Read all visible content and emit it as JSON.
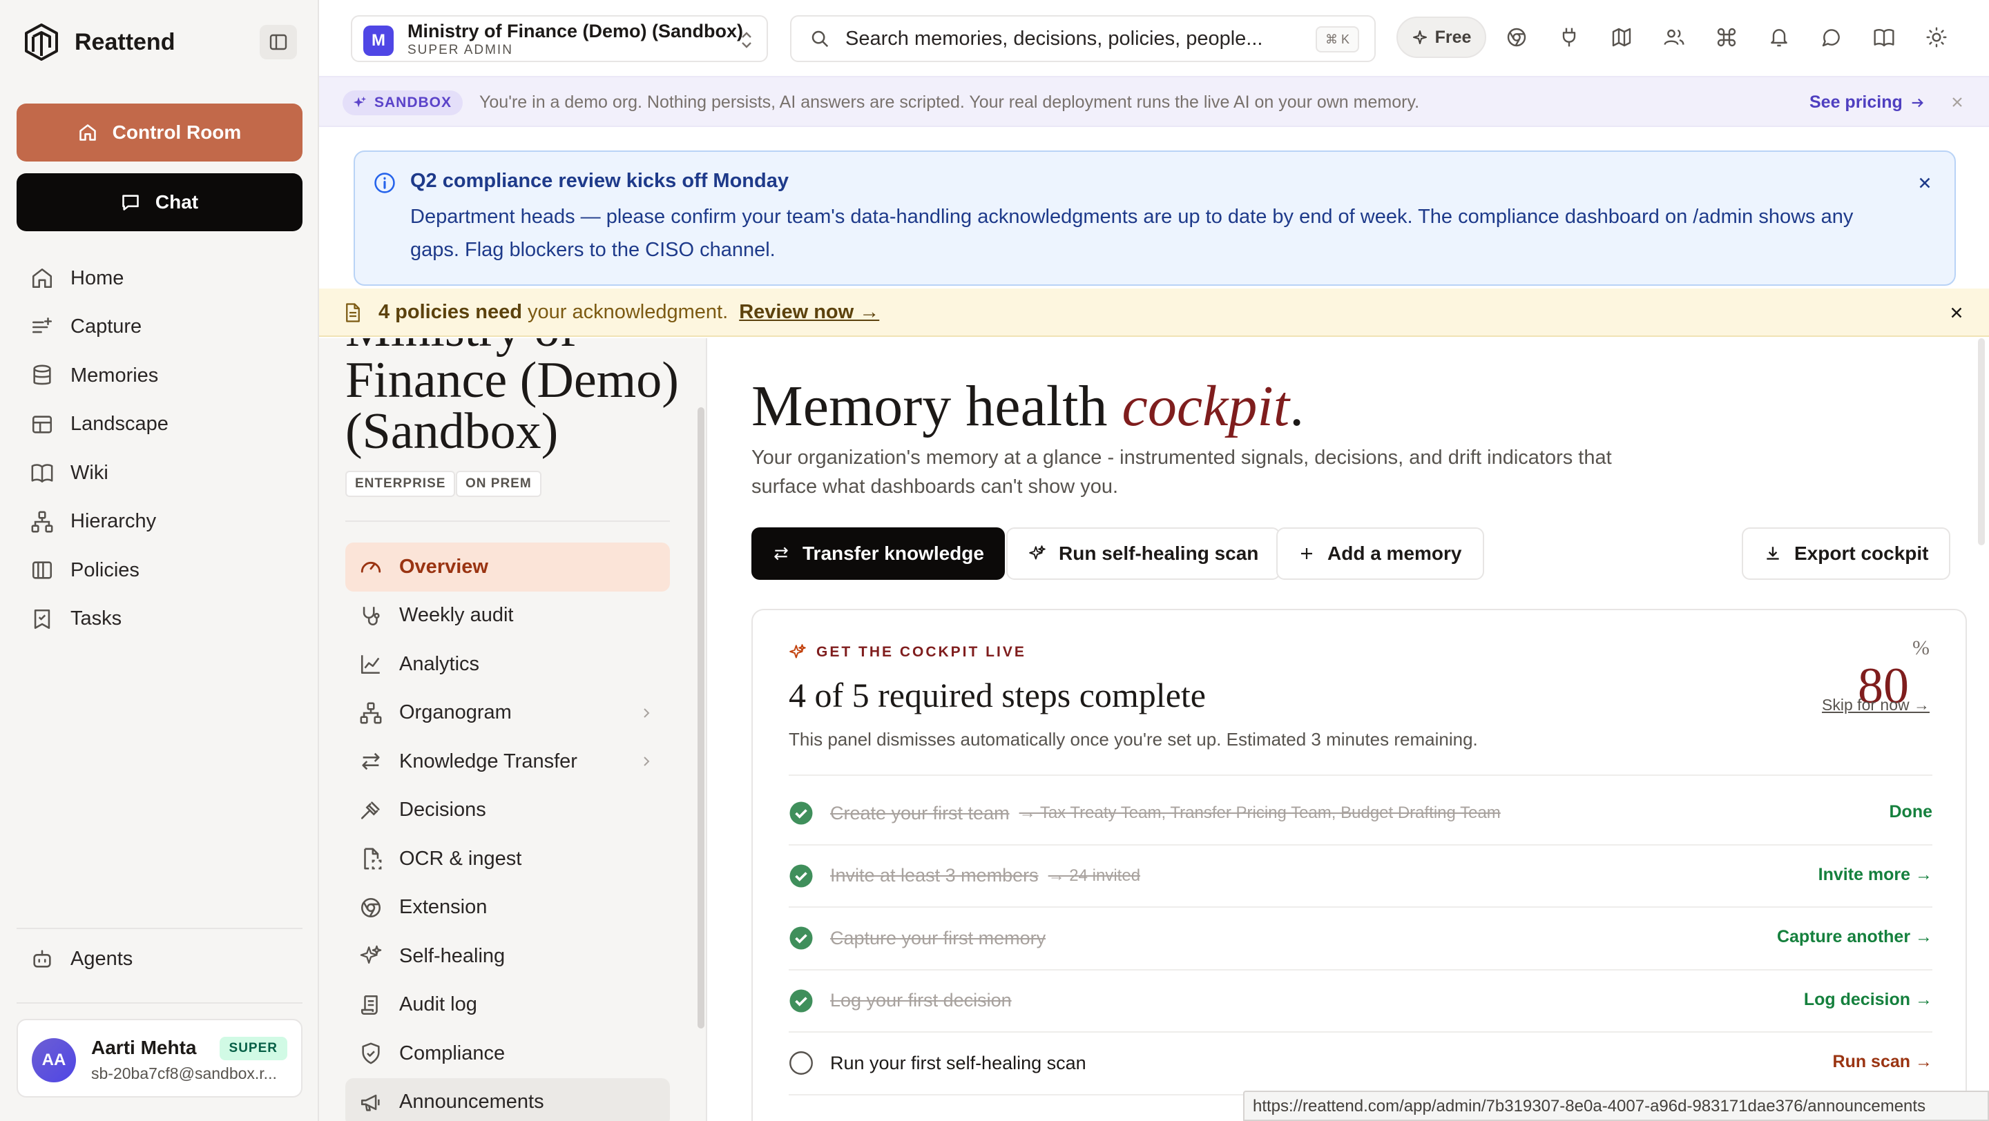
{
  "app": {
    "name": "Reattend"
  },
  "sidebar": {
    "primary_buttons": [
      {
        "label": "Control Room",
        "icon": "home-icon"
      },
      {
        "label": "Chat",
        "icon": "chat-bubble-icon"
      }
    ],
    "items": [
      {
        "label": "Home",
        "icon": "home-icon"
      },
      {
        "label": "Capture",
        "icon": "capture-icon"
      },
      {
        "label": "Memories",
        "icon": "database-icon"
      },
      {
        "label": "Landscape",
        "icon": "landscape-icon"
      },
      {
        "label": "Wiki",
        "icon": "book-icon"
      },
      {
        "label": "Hierarchy",
        "icon": "hierarchy-icon"
      },
      {
        "label": "Policies",
        "icon": "policies-icon"
      },
      {
        "label": "Tasks",
        "icon": "tasks-icon"
      }
    ],
    "agents_label": "Agents",
    "user": {
      "initials": "AA",
      "name": "Aarti Mehta",
      "badge": "SUPER",
      "email": "sb-20ba7cf8@sandbox.r..."
    }
  },
  "topbar": {
    "org": {
      "initial": "M",
      "name": "Ministry of Finance (Demo) (Sandbox)",
      "role": "SUPER ADMIN"
    },
    "search": {
      "placeholder": "Search memories, decisions, policies, people...",
      "shortcut": "⌘ K"
    },
    "plan": "Free",
    "icons": [
      "chrome-icon",
      "plug-icon",
      "map-icon",
      "users-icon",
      "command-icon",
      "bell-icon",
      "message-icon",
      "book-open-icon",
      "sun-icon"
    ]
  },
  "sandbox_banner": {
    "tag": "SANDBOX",
    "text": "You're in a demo org. Nothing persists, AI answers are scripted. Your real deployment runs the live AI on your own memory.",
    "link": "See pricing"
  },
  "announcement": {
    "title": "Q2 compliance review kicks off Monday",
    "body": "Department heads — please confirm your team's data-handling acknowledgments are up to date by end of week. The compliance dashboard on /admin shows any gaps. Flag blockers to the CISO channel."
  },
  "policy_banner": {
    "bold": "4 policies need",
    "text": "your acknowledgment.",
    "link": "Review now →"
  },
  "subnav": {
    "org_title": "Ministry of Finance (Demo) (Sandbox)",
    "tags": [
      "ENTERPRISE",
      "ON PREM"
    ],
    "items": [
      {
        "label": "Overview",
        "icon": "gauge-icon",
        "active": true
      },
      {
        "label": "Weekly audit",
        "icon": "stethoscope-icon"
      },
      {
        "label": "Analytics",
        "icon": "line-chart-icon"
      },
      {
        "label": "Organogram",
        "icon": "org-chart-icon",
        "chevron": true
      },
      {
        "label": "Knowledge Transfer",
        "icon": "transfer-icon",
        "chevron": true
      },
      {
        "label": "Decisions",
        "icon": "gavel-icon"
      },
      {
        "label": "OCR & ingest",
        "icon": "file-scan-icon"
      },
      {
        "label": "Extension",
        "icon": "chrome-icon"
      },
      {
        "label": "Self-healing",
        "icon": "sparkles-icon"
      },
      {
        "label": "Audit log",
        "icon": "scroll-icon"
      },
      {
        "label": "Compliance",
        "icon": "shield-check-icon"
      },
      {
        "label": "Announcements",
        "icon": "megaphone-icon",
        "hover": true
      }
    ]
  },
  "main": {
    "title_plain": "Memory health",
    "title_em": "cockpit",
    "title_end": ".",
    "subtitle": "Your organization's memory at a glance - instrumented signals, decisions, and drift indicators that surface what dashboards can't show you.",
    "actions": [
      {
        "label": "Transfer knowledge",
        "icon": "transfer-icon"
      },
      {
        "label": "Run self-healing scan",
        "icon": "sparkles-icon"
      },
      {
        "label": "Add a memory",
        "icon": "plus-icon"
      }
    ],
    "export_label": "Export cockpit",
    "setup": {
      "eyebrow": "GET THE COCKPIT LIVE",
      "title": "4 of 5 required steps complete",
      "description": "This panel dismisses automatically once you're set up. Estimated 3 minutes remaining.",
      "percent": "80",
      "percent_symbol": "%",
      "skip": "Skip for now →",
      "steps": [
        {
          "label": "Create your first team",
          "detail": "→ Tax Treaty Team, Transfer Pricing Team, Budget Drafting Team",
          "action": "Done",
          "done": true
        },
        {
          "label": "Invite at least 3 members",
          "detail": "→ 24 invited",
          "action": "Invite more →",
          "done": true
        },
        {
          "label": "Capture your first memory",
          "detail": "",
          "action": "Capture another →",
          "done": true
        },
        {
          "label": "Log your first decision",
          "detail": "",
          "action": "Log decision →",
          "done": true
        },
        {
          "label": "Run your first self-healing scan",
          "detail": "",
          "action": "Run scan →",
          "done": false
        }
      ]
    }
  },
  "status_url": "https://reattend.com/app/admin/7b319307-8e0a-4007-a96d-983171dae376/announcements",
  "colors": {
    "accent": "#c2694a",
    "brand_dark": "#0c0a09",
    "cockpit_red": "#7f1d1d",
    "success": "#15803d",
    "sandbox_purple": "#5b43c9"
  }
}
